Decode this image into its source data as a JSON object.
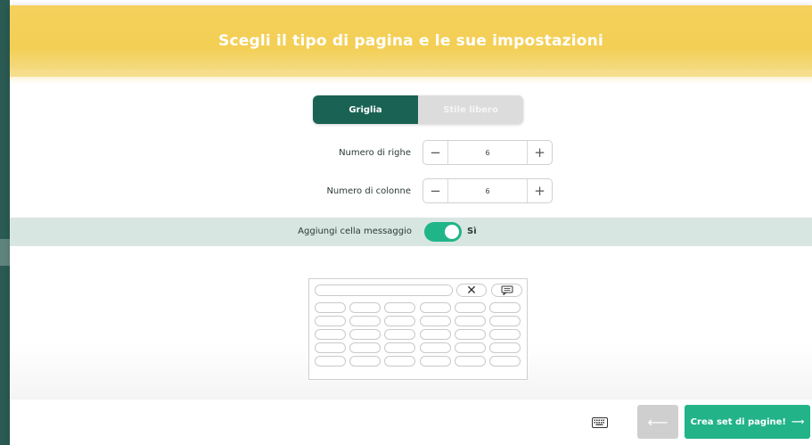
{
  "header": {
    "title": "Scegli il tipo di pagina e le sue impostazioni"
  },
  "page_type": {
    "options": [
      "Griglia",
      "Stile libero"
    ],
    "selected": "Griglia"
  },
  "rows": {
    "label": "Numero di righe",
    "value": "6",
    "minus": "−",
    "plus": "+"
  },
  "columns": {
    "label": "Numero di colonne",
    "value": "6",
    "minus": "−",
    "plus": "+"
  },
  "message_cell": {
    "label": "Aggiungi cella messaggio",
    "state_label": "Sì",
    "enabled": true
  },
  "preview": {
    "rows": 5,
    "columns": 6,
    "close_glyph": "✕"
  },
  "footer": {
    "back_label": "⟵",
    "create_label": "Crea set di pagine!",
    "create_arrow": "⟶"
  },
  "colors": {
    "header": "#f3cf55",
    "primary_dark": "#1a6354",
    "accent": "#22b389",
    "band": "#d8e6e2"
  },
  "icons": {
    "keyboard": "keyboard-icon",
    "chat": "chat-icon",
    "close": "close-icon"
  }
}
